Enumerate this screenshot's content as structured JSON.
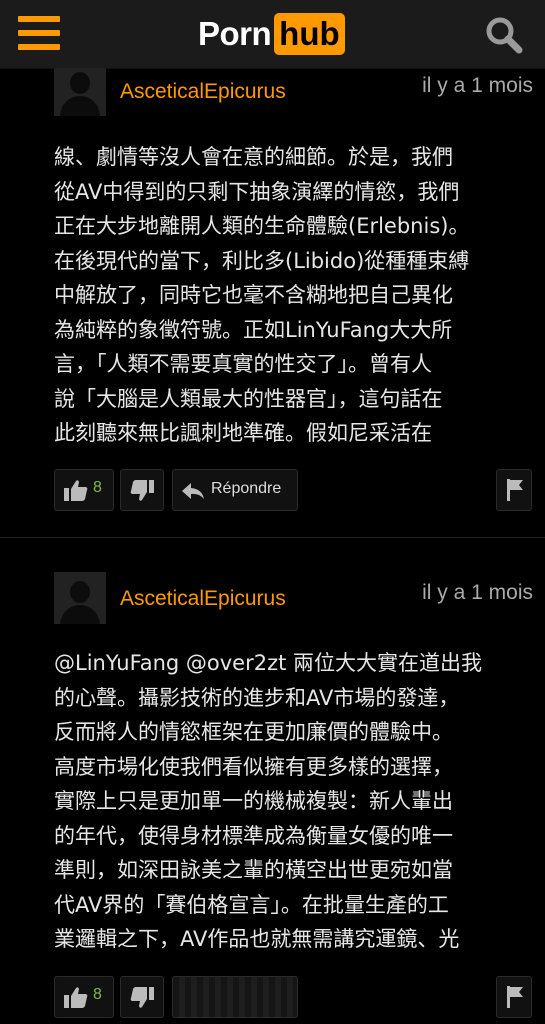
{
  "header": {
    "logo_part1": "Porn",
    "logo_part2": "hub",
    "brand_color": "#ff9900"
  },
  "comments": [
    {
      "username": "AsceticalEpicurus",
      "timestamp": "il y a 1 mois",
      "text": "線、劇情等沒人會在意的細節。於是，我們\n從AV中得到的只剩下抽象演繹的情慾，我們\n正在大步地離開人類的生命體驗(Erlebnis)。\n在後現代的當下，利比多(Libido)從種種束縛\n中解放了，同時它也毫不含糊地把自己異化\n為純粹的象徵符號。正如LinYuFang大大所\n言，「人類不需要真實的性交了」。曾有人\n說「大腦是人類最大的性器官」，這句話在\n此刻聽來無比諷刺地準確。假如尼采活在",
      "likes": "8",
      "reply_label": "Répondre"
    },
    {
      "username": "AsceticalEpicurus",
      "timestamp": "il y a 1 mois",
      "text": "@LinYuFang @over2zt 兩位大大實在道出我\n的心聲。攝影技術的進步和AV市場的發達，\n反而將人的情慾框架在更加廉價的體驗中。\n高度市場化使我們看似擁有更多樣的選擇，\n實際上只是更加單一的機械複製：新人輩出\n的年代，使得身材標準成為衡量女優的唯一\n準則，如深田詠美之輩的橫空出世更宛如當\n代AV界的「賽伯格宣言」。在批量生產的工\n業邏輯之下，AV作品也就無需講究運鏡、光",
      "likes": "8"
    }
  ],
  "icons": {
    "menu": "hamburger-menu-icon",
    "search": "search-icon",
    "like": "thumbs-up-icon",
    "dislike": "thumbs-down-icon",
    "reply": "reply-arrow-icon",
    "flag": "flag-icon"
  }
}
